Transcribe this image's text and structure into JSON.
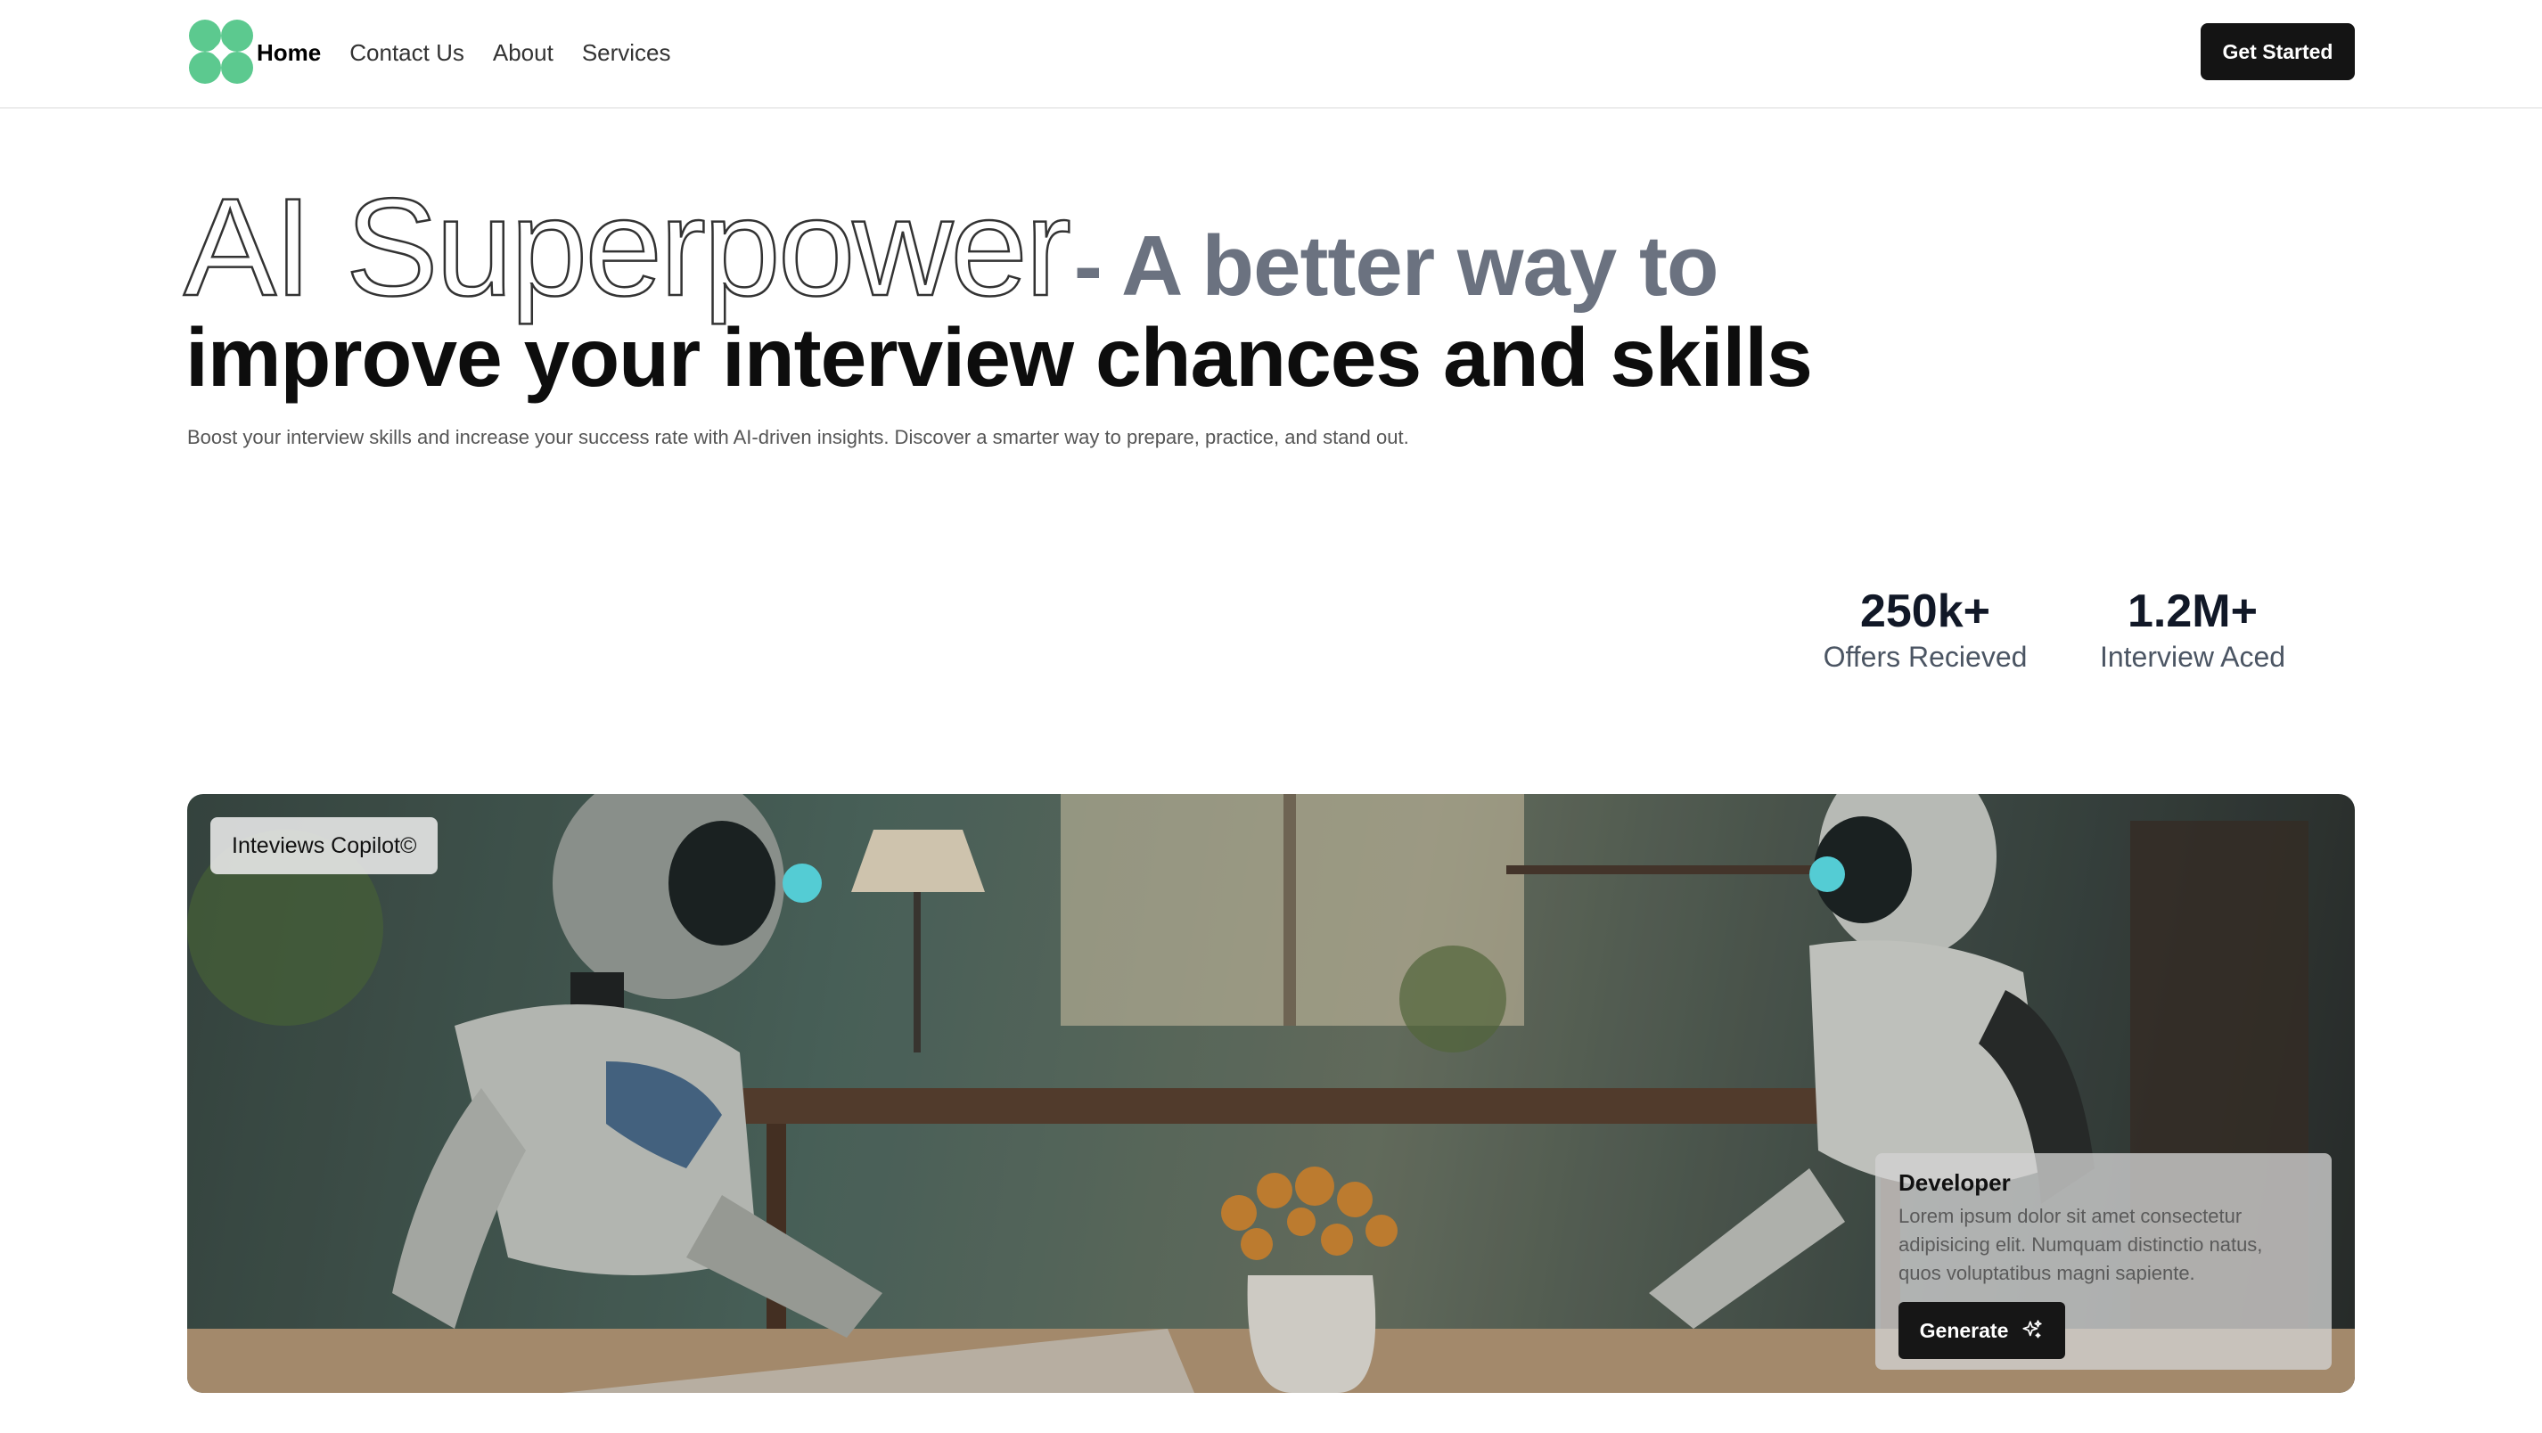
{
  "nav": {
    "logo_icon": "clover-logo-icon",
    "links": [
      {
        "label": "Home",
        "active": true
      },
      {
        "label": "Contact Us",
        "active": false
      },
      {
        "label": "About",
        "active": false
      },
      {
        "label": "Services",
        "active": false
      }
    ],
    "cta_label": "Get Started"
  },
  "hero": {
    "title_outline": "AI Superpower",
    "title_gray": "- A better way to",
    "title_line2": "improve your interview chances and skills",
    "subtitle": "Boost your interview skills and increase your success rate with AI-driven insights. Discover a smarter way to prepare, practice, and stand out."
  },
  "stats": [
    {
      "value": "250k+",
      "label": "Offers Recieved"
    },
    {
      "value": "1.2M+",
      "label": "Interview Aced"
    }
  ],
  "feature": {
    "badge": "Inteviews Copilot©",
    "card": {
      "title": "Developer",
      "text": "Lorem ipsum dolor sit amet consectetur adipisicing elit. Numquam distinctio natus, quos voluptatibus magni sapiente.",
      "button_label": "Generate",
      "button_icon": "sparkles-icon"
    }
  },
  "colors": {
    "logo_green": "#5cc98f",
    "button_dark": "#141414",
    "hero_gray": "#6b7280"
  }
}
